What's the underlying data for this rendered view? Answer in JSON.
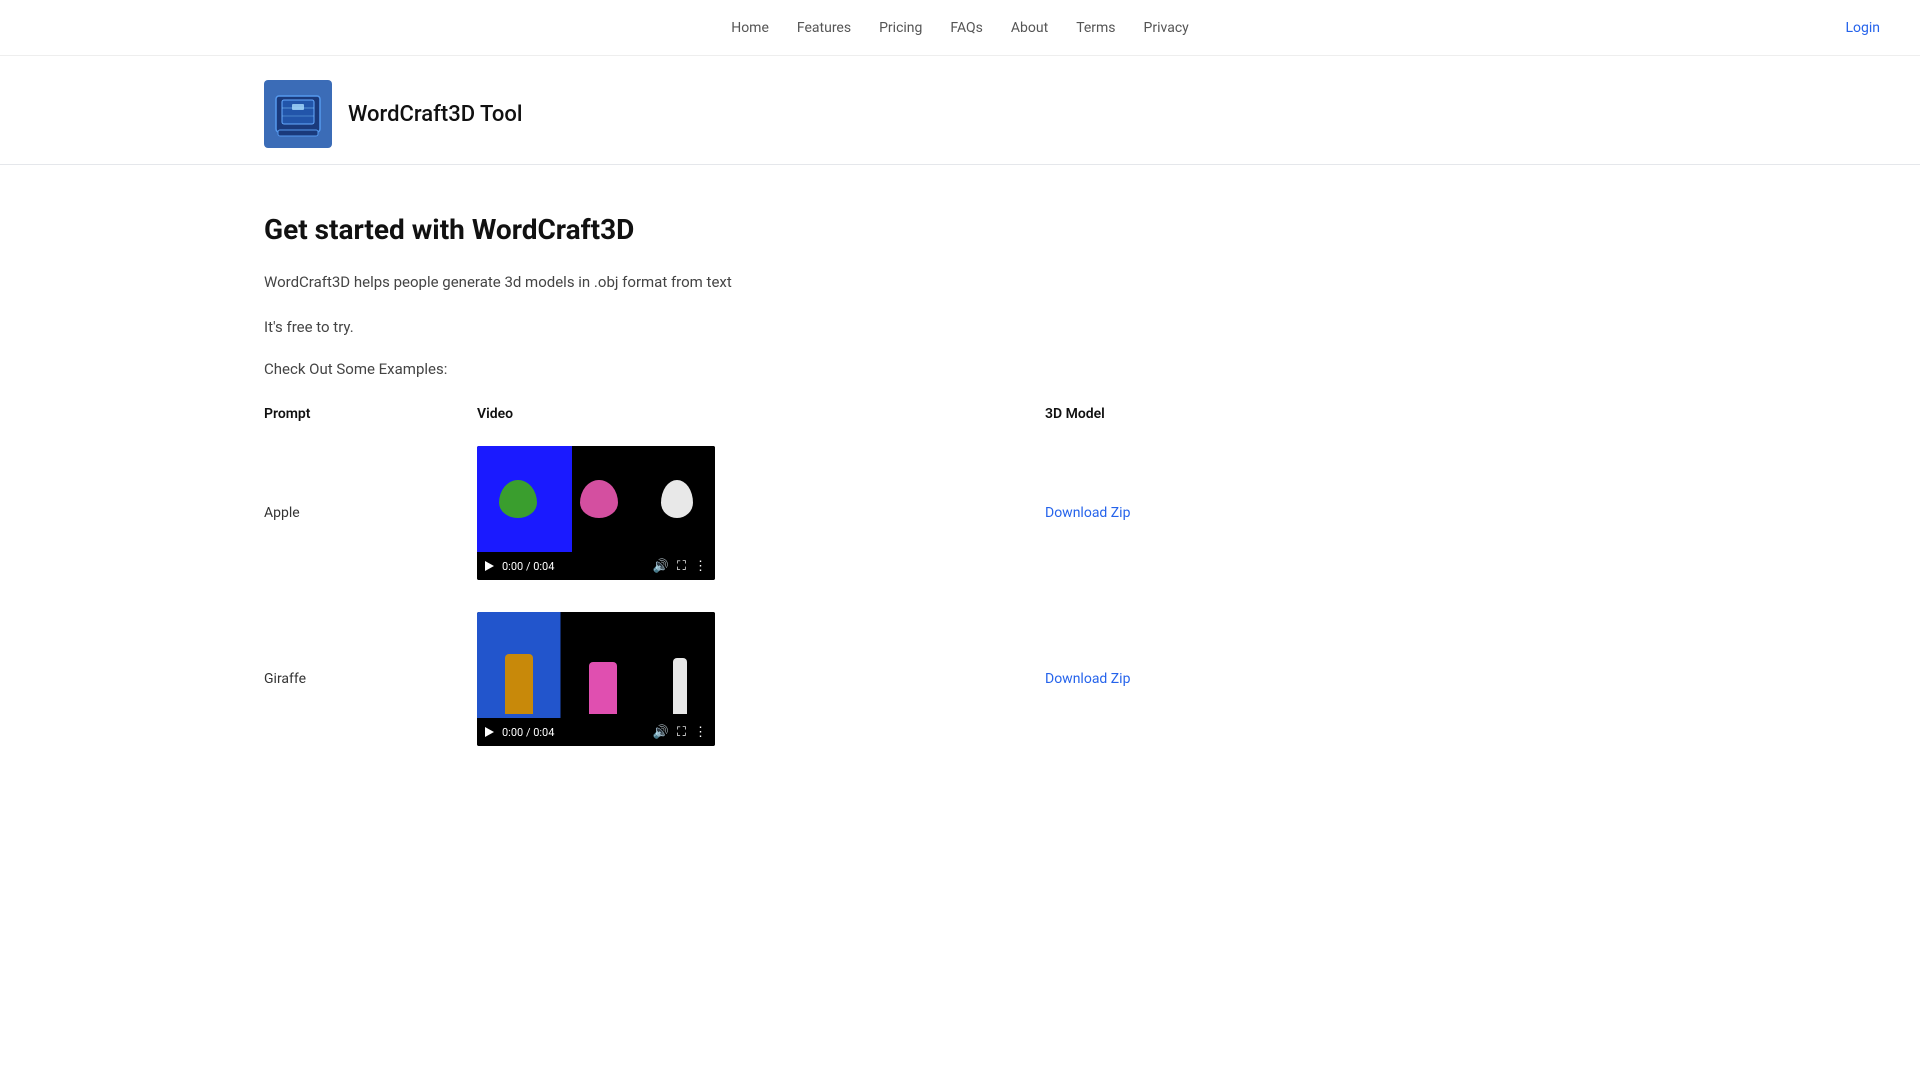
{
  "nav": {
    "links": [
      {
        "label": "Home",
        "href": "#"
      },
      {
        "label": "Features",
        "href": "#"
      },
      {
        "label": "Pricing",
        "href": "#"
      },
      {
        "label": "FAQs",
        "href": "#"
      },
      {
        "label": "About",
        "href": "#"
      },
      {
        "label": "Terms",
        "href": "#"
      },
      {
        "label": "Privacy",
        "href": "#"
      }
    ],
    "login_label": "Login"
  },
  "brand": {
    "title": "WordCraft3D Tool"
  },
  "hero": {
    "heading": "Get started with WordCraft3D",
    "description": "WordCraft3D helps people generate 3d models in .obj format from text",
    "free_text": "It's free to try.",
    "examples_label": "Check Out Some Examples:"
  },
  "table": {
    "columns": [
      "Prompt",
      "Video",
      "3D Model"
    ],
    "rows": [
      {
        "prompt": "Apple",
        "video_time": "0:00 / 0:04",
        "download_label": "Download Zip",
        "download_href": "#"
      },
      {
        "prompt": "Giraffe",
        "video_time": "0:00 / 0:04",
        "download_label": "Download Zip",
        "download_href": "#"
      }
    ]
  }
}
